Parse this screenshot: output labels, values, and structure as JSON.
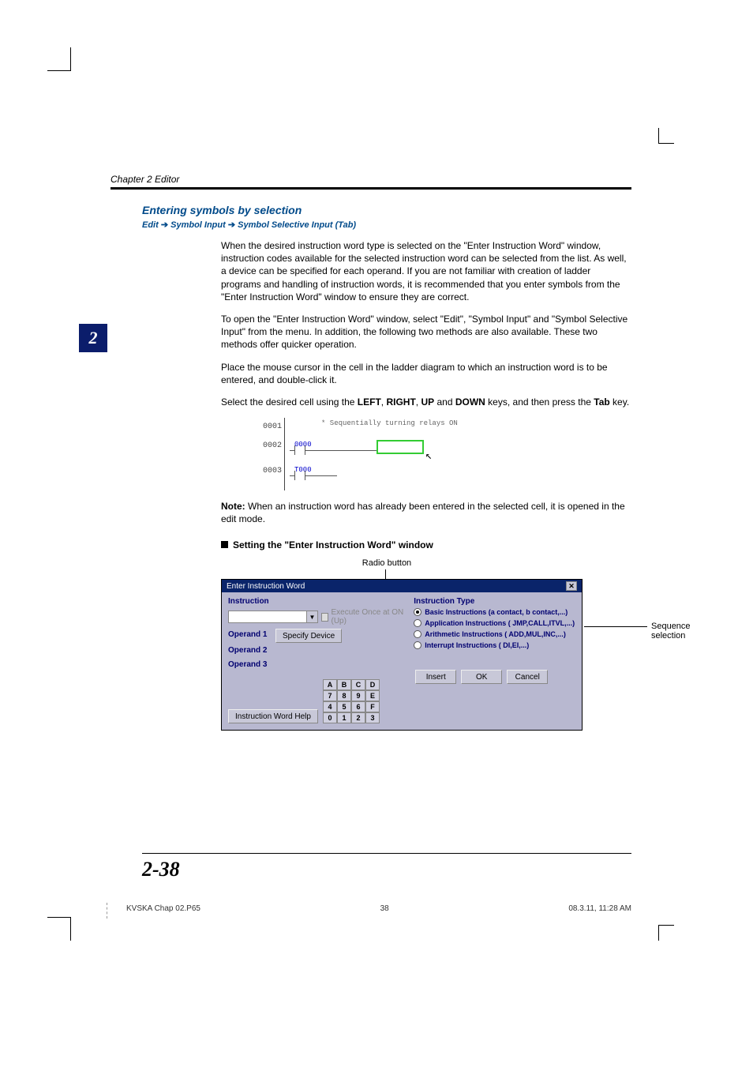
{
  "header": {
    "chapter": "Chapter 2  Editor"
  },
  "side_tab": "2",
  "section": {
    "title": "Entering symbols by selection",
    "path_prefix": "Edit",
    "path_mid": "Symbol Input",
    "path_suffix": "Symbol Selective Input (Tab)"
  },
  "paragraphs": {
    "p1": "When the desired instruction word type is selected on the \"Enter Instruction Word\" window, instruction codes available for the selected instruction word can be selected from the list. As well, a device can be specified for each operand. If you are not familiar with creation of ladder programs and handling of instruction words, it is recommended that you enter symbols from the \"Enter Instruction Word\" window to ensure they are correct.",
    "p2": "To open the \"Enter Instruction Word\" window, select \"Edit\", \"Symbol Input\" and \"Symbol Selective Input\" from the menu. In addition, the following two methods are also available. These two methods offer quicker operation.",
    "p3": "Place the mouse cursor in the cell in the ladder diagram to which an instruction word is to be entered, and double-click it.",
    "p4a": "Select the desired cell using the ",
    "p4_left": "LEFT",
    "p4_comma1": ", ",
    "p4_right": "RIGHT",
    "p4_comma2": ", ",
    "p4_up": "UP",
    "p4_and": " and ",
    "p4_down": "DOWN",
    "p4b": " keys, and then press the ",
    "p4_tab": "Tab",
    "p4c": " key.",
    "note_label": "Note:",
    "note_text": " When an instruction word has already been entered in the selected cell, it is opened in the edit mode."
  },
  "ladder": {
    "rows": [
      "0001",
      "0002",
      "0003"
    ],
    "comment": "* Sequentially turning relays ON",
    "contacts": [
      "0000",
      "T000"
    ]
  },
  "subheading": "Setting the \"Enter Instruction Word\" window",
  "radio_caption": "Radio button",
  "dialog": {
    "title": "Enter Instruction Word",
    "instruction_label": "Instruction",
    "exec_once_label": "Execute Once at ON (Up)",
    "specify_device": "Specify Device",
    "op1": "Operand 1",
    "op2": "Operand 2",
    "op3": "Operand 3",
    "type_label": "Instruction Type",
    "radios": [
      "Basic Instructions (a contact, b contact,...)",
      "Application Instructions ( JMP,CALL,ITVL,...)",
      "Arithmetic Instructions ( ADD,MUL,INC,...)",
      "Interrupt Instructions ( DI,EI,...)"
    ],
    "help_btn": "Instruction Word Help",
    "keypad": [
      "A",
      "B",
      "C",
      "D",
      "7",
      "8",
      "9",
      "E",
      "4",
      "5",
      "6",
      "F",
      "0",
      "1",
      "2",
      "3",
      ".",
      "-"
    ],
    "insert": "Insert",
    "ok": "OK",
    "cancel": "Cancel"
  },
  "annotation": "Sequence selection",
  "page_number": "2-38",
  "footer": {
    "file": "KVSKA Chap 02.P65",
    "page": "38",
    "timestamp": "08.3.11, 11:28 AM"
  }
}
